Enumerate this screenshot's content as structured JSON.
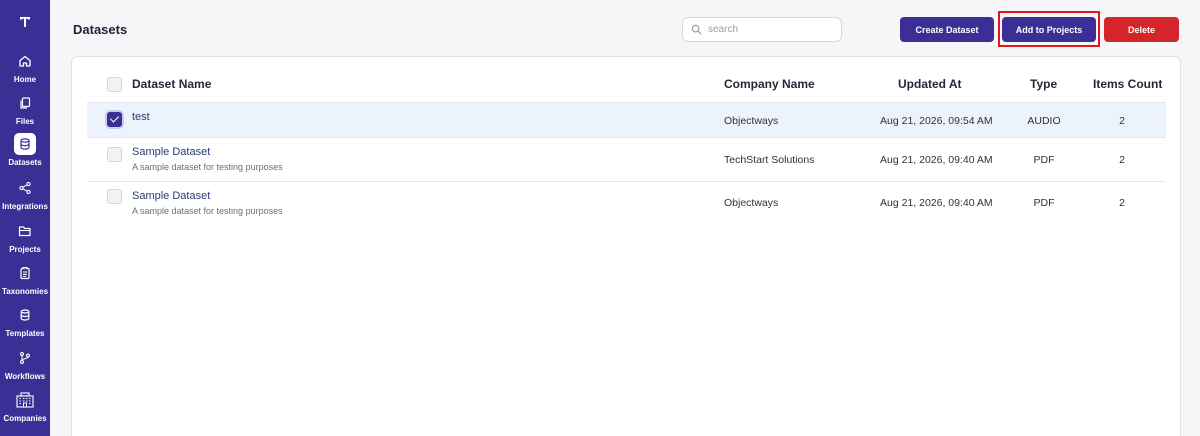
{
  "page": {
    "title": "Datasets"
  },
  "sidebar": {
    "items": [
      {
        "label": "Home",
        "icon": "home-icon"
      },
      {
        "label": "Files",
        "icon": "files-icon"
      },
      {
        "label": "Datasets",
        "icon": "database-icon",
        "active": true
      },
      {
        "label": "Integrations",
        "icon": "share-icon"
      },
      {
        "label": "Projects",
        "icon": "folder-icon"
      },
      {
        "label": "Taxonomies",
        "icon": "clipboard-icon"
      },
      {
        "label": "Templates",
        "icon": "stack-icon"
      },
      {
        "label": "Workflows",
        "icon": "git-branch-icon"
      },
      {
        "label": "Companies",
        "icon": "building-icon"
      }
    ]
  },
  "search": {
    "placeholder": "search",
    "value": ""
  },
  "toolbar": {
    "create_label": "Create Dataset",
    "add_label": "Add to Projects",
    "delete_label": "Delete"
  },
  "table": {
    "columns": [
      "Dataset Name",
      "Company Name",
      "Updated At",
      "Type",
      "Items Count"
    ],
    "rows": [
      {
        "name": "test",
        "description": "",
        "company": "Objectways",
        "updated": "Aug 21, 2026, 09:54 AM",
        "type": "AUDIO",
        "count": "2",
        "selected": true
      },
      {
        "name": "Sample Dataset",
        "description": "A sample dataset for testing purposes",
        "company": "TechStart Solutions",
        "updated": "Aug 21, 2026, 09:40 AM",
        "type": "PDF",
        "count": "2",
        "selected": false
      },
      {
        "name": "Sample Dataset",
        "description": "A sample dataset for testing purposes",
        "company": "Objectways",
        "updated": "Aug 21, 2026, 09:40 AM",
        "type": "PDF",
        "count": "2",
        "selected": false
      }
    ]
  },
  "colors": {
    "brand": "#3b2f96",
    "danger": "#d4262a",
    "highlight": "#e3161b",
    "selected_row": "#edf3fc"
  }
}
